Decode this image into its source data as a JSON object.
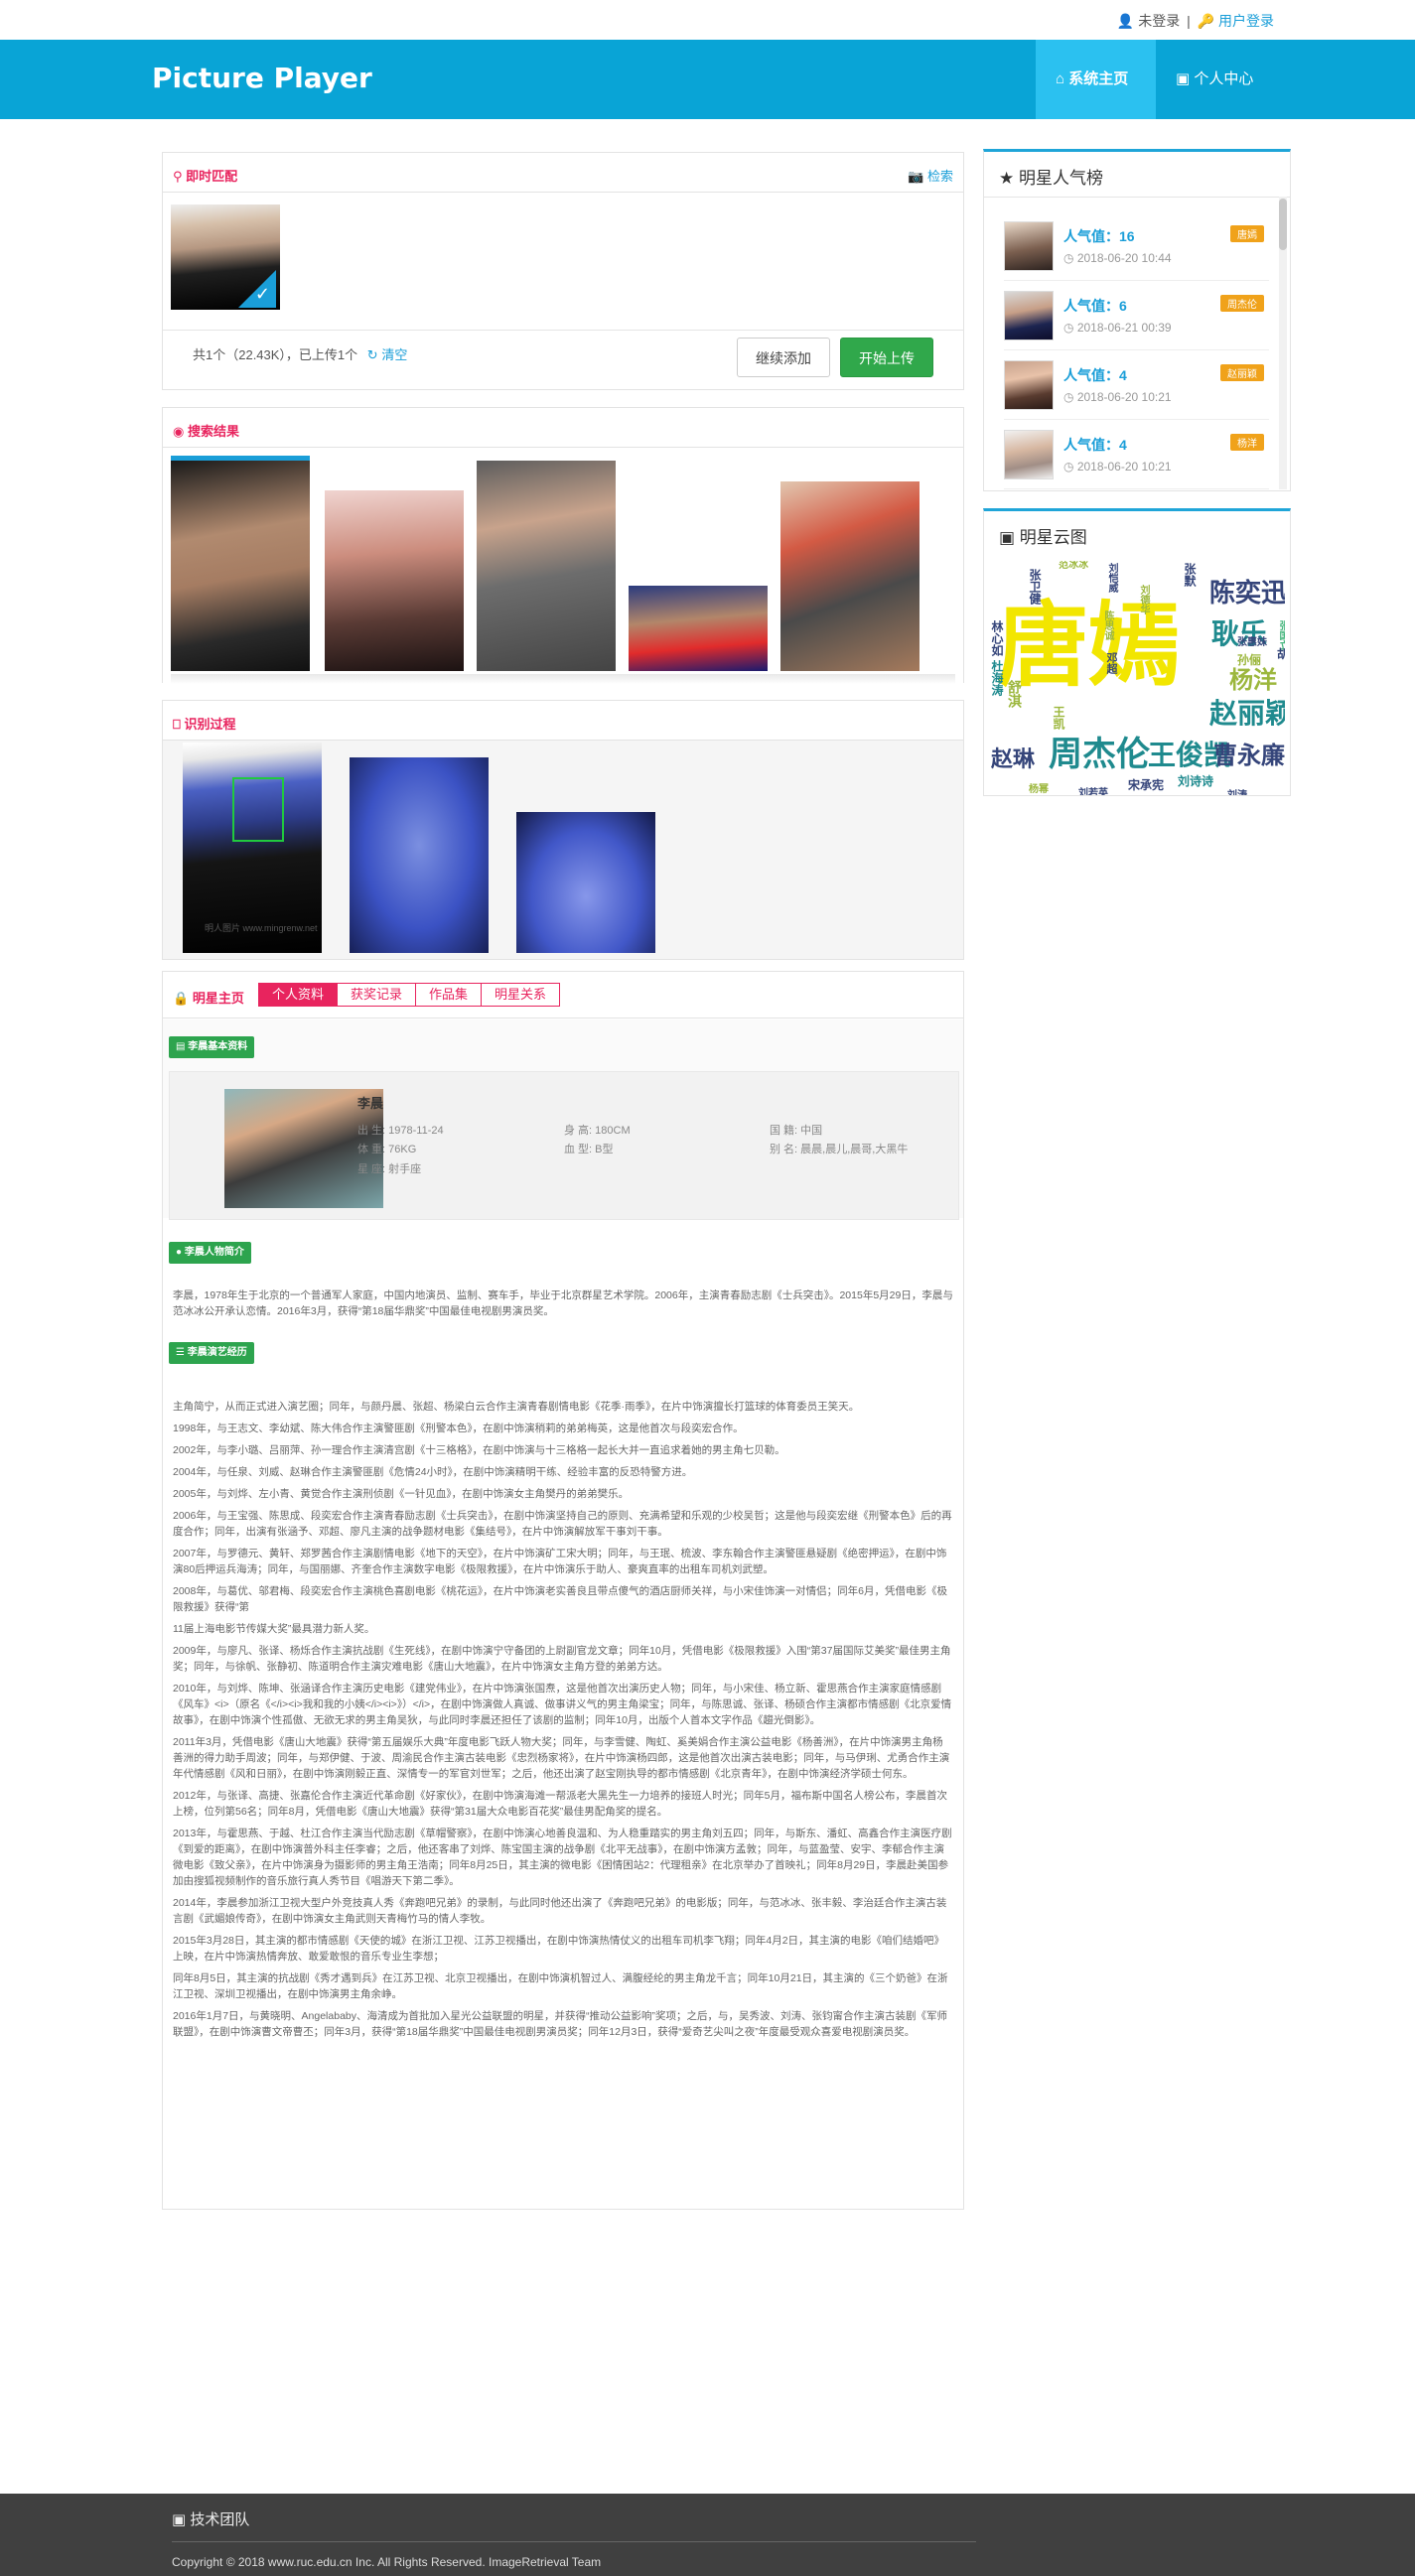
{
  "topbar": {
    "status": "未登录",
    "sep": "|",
    "login": "用户登录"
  },
  "nav": {
    "brand": "Picture Player",
    "home": "系统主页",
    "personal": "个人中心"
  },
  "match": {
    "title": "即时匹配",
    "search_link": "检索",
    "summary": "共1个（22.43K），已上传1个",
    "clear": "清空",
    "continue": "继续添加",
    "upload": "开始上传"
  },
  "results": {
    "title": "搜索结果"
  },
  "process": {
    "title": "识别过程",
    "watermark": "明人图片 www.mingrenw.net"
  },
  "star": {
    "title": "明星主页",
    "tabs": [
      "个人资料",
      "获奖记录",
      "作品集",
      "明星关系"
    ],
    "basic_tag": "李晨基本资料",
    "name": "李晨",
    "birth": "出 生: 1978-11-24",
    "height": "身 高: 180CM",
    "nation": "国 籍: 中国",
    "weight": "体 重: 76KG",
    "blood": "血 型: B型",
    "alias": "别 名: 晨晨,晨儿,晨哥,大黑牛",
    "sign": "星 座: 射手座",
    "intro_tag": "李晨人物简介",
    "intro": "李晨，1978年生于北京的一个普通军人家庭，中国内地演员、监制、赛车手，毕业于北京群星艺术学院。2006年，主演青春励志剧《士兵突击》。2015年5月29日，李晨与范冰冰公开承认恋情。2016年3月，获得“第18届华鼎奖”中国最佳电视剧男演员奖。",
    "career_tag": "李晨演艺经历",
    "career": [
      "主角简宁，从而正式进入演艺圈；同年，与颜丹晨、张超、杨梁白云合作主演青春剧情电影《花季·雨季》，在片中饰演擅长打篮球的体育委员王笑天。",
      "1998年，与王志文、李幼斌、陈大伟合作主演警匪剧《刑警本色》，在剧中饰演稍莉的弟弟梅英，这是他首次与段奕宏合作。",
      "2002年，与李小璐、吕丽萍、孙一理合作主演清宫剧《十三格格》，在剧中饰演与十三格格一起长大并一直追求着她的男主角七贝勒。",
      "2004年，与任泉、刘威、赵琳合作主演警匪剧《危情24小时》，在剧中饰演精明干练、经验丰富的反恐特警方进。",
      "2005年，与刘烨、左小青、黄觉合作主演刑侦剧《一针见血》，在剧中饰演女主角樊丹的弟弟樊乐。",
      "2006年，与王宝强、陈思成、段奕宏合作主演青春励志剧《士兵突击》，在剧中饰演坚持自己的原则、充满希望和乐观的少校吴哲；这是他与段奕宏继《刑警本色》后的再度合作；同年，出演有张涵予、邓超、廖凡主演的战争题材电影《集结号》，在片中饰演解放军干事刘干事。",
      "2007年，与罗德元、黄轩、郑罗茜合作主演剧情电影《地下的天空》，在片中饰演矿工宋大明；同年，与王珉、梳波、李东翰合作主演警匪悬疑剧《绝密押运》，在剧中饰演80后押运兵海涛；同年，与国丽娜、齐奎合作主演数字电影《极限救援》，在片中饰演乐于助人、豪爽直率的出租车司机刘武塑。",
      "2008年，与葛优、邬君梅、段奕宏合作主演桃色喜剧电影《桃花运》，在片中饰演老实善良且带点傻气的酒店厨师关祥，与小宋佳饰演一对情侣；同年6月，凭借电影《极限救援》获得“第",
      "11届上海电影节传媒大奖”最具潜力新人奖。",
      "2009年，与廖凡、张译、杨烁合作主演抗战剧《生死线》，在剧中饰演宁守备团的上尉副官龙文章；同年10月，凭借电影《极限救援》入围“第37届国际艾美奖”最佳男主角奖；同年，与徐帆、张静初、陈道明合作主演灾难电影《唐山大地震》，在片中饰演女主角方登的弟弟方达。",
      "2010年，与刘烨、陈坤、张涵译合作主演历史电影《建党伟业》，在片中饰演张国焘，这是他首次出演历史人物；同年，与小宋佳、杨立新、霍思燕合作主演家庭情感剧《风车》<i>（原名《</i><i>我和我的小姨</i><i>》）</i>，在剧中饰演做人真诚、做事讲义气的男主角梁宝；同年，与陈思诚、张译、杨硕合作主演都市情感剧《北京爱情故事》，在剧中饰演个性孤傲、无欲无求的男主角吴狄，与此同时李晨还担任了该剧的监制；同年10月，出版个人首本文字作品《趨光倒影》。",
      "2011年3月，凭借电影《唐山大地震》获得“第五届娱乐大典”年度电影飞跃人物大奖；同年，与李雪健、陶虹、奚美娟合作主演公益电影《杨善洲》，在片中饰演男主角杨善洲的得力助手周波；同年，与郑伊健、于波、周渝民合作主演古装电影《忠烈杨家将》，在片中饰演杨四郎，这是他首次出演古装电影；同年，与马伊琍、尤勇合作主演年代情感剧《风和日丽》，在剧中饰演刚毅正直、深情专一的军官刘世军；之后，他还出演了赵宝刚执导的都市情感剧《北京青年》，在剧中饰演经济学硕士何东。",
      "2012年，与张译、高捷、张嘉伦合作主演近代革命剧《好家伙》，在剧中饰演海滩一帮派老大黑先生一力培养的接班人时光；同年5月，福布斯中国名人榜公布，李晨首次上榜，位列第56名；同年8月，凭借电影《唐山大地震》获得“第31届大众电影百花奖”最佳男配角奖的提名。",
      "2013年，与霍思燕、于越、杜江合作主演当代励志剧《草帽警察》，在剧中饰演心地善良温和、为人稳重踏实的男主角刘五四；同年，与斯东、潘虹、高鑫合作主演医疗剧《到爱的距离》，在剧中饰演普外科主任李睿；之后，他还客串了刘烨、陈宝国主演的战争剧《北平无战事》，在剧中饰演方孟敦；同年，与蓝盈莹、安宇、李郁合作主演微电影《致父亲》，在片中饰演身为摄影师的男主角王浩南；同年8月25日，其主演的微电影《困情困站2：代理租亲》在北京举办了首映礼；同年8月29日，李晨赴美国参加由搜狐视频制作的音乐旅行真人秀节目《唱游天下第二季》。",
      "2014年，李晨参加浙江卫视大型户外竞技真人秀《奔跑吧兄弟》的录制，与此同时他还出演了《奔跑吧兄弟》的电影版；同年，与范冰冰、张丰毅、李治廷合作主演古装言剧《武媚娘传奇》，在剧中饰演女主角武则天青梅竹马的情人李牧。",
      "2015年3月28日，其主演的都市情感剧《天使的城》在浙江卫视、江苏卫视播出，在剧中饰演热情仗义的出租车司机李飞翔；同年4月2日，其主演的电影《咱们结婚吧》上映，在片中饰演热情奔放、敢爱敢恨的音乐专业生李想；",
      "同年8月5日，其主演的抗战剧《秀才遇到兵》在江苏卫视、北京卫视播出，在剧中饰演机智过人、满腹经纶的男主角龙千言；同年10月21日，其主演的《三个奶爸》在浙江卫视、深圳卫视播出，在剧中饰演男主角余峥。",
      "2016年1月7日，与黄晓明、Angelababy、海清成为首批加入星光公益联盟的明星，并获得“推动公益影响”奖项；之后，与，吴秀波、刘涛、张钧甯合作主演古装剧《军师联盟》，在剧中饰演曹文帝曹丕；同年3月，获得“第18届华鼎奖”中国最佳电视剧男演员奖；同年12月3日，获得“爱奇艺尖叫之夜”年度最受观众喜爱电视剧演员奖。"
    ]
  },
  "ranking": {
    "title": "明星人气榜",
    "items": [
      {
        "pop": "人气值：16",
        "date": "2018-06-20 10:44",
        "badge": "唐嫣"
      },
      {
        "pop": "人气值：6",
        "date": "2018-06-21 00:39",
        "badge": "周杰伦"
      },
      {
        "pop": "人气值：4",
        "date": "2018-06-20 10:21",
        "badge": "赵丽颖"
      },
      {
        "pop": "人气值：4",
        "date": "2018-06-20 10:21",
        "badge": "杨洋"
      }
    ]
  },
  "cloud": {
    "title": "明星云图",
    "words": [
      "唐嫣",
      "陈奕迅",
      "耿乐",
      "杨洋",
      "赵丽颖",
      "周杰伦",
      "王俊凯",
      "曹永廉",
      "赵琳",
      "张卫健",
      "范冰冰",
      "刘恺威",
      "林心如",
      "舒淇",
      "陈思诚",
      "刘若英",
      "杜海涛",
      "刘德华",
      "张国立",
      "张惠妹",
      "孙俪",
      "胡歌",
      "刘诗诗",
      "宋承宪",
      "张默",
      "邓超",
      "杨幂",
      "刘涛",
      "王凯"
    ],
    "colors": {
      "big": "#f2e600",
      "navy": "#35457a",
      "teal": "#1f8a8e",
      "olive": "#9cb73d",
      "green": "#41b47a"
    }
  },
  "footer": {
    "team": "技术团队",
    "copyright": "Copyright © 2018 www.ruc.edu.cn Inc. All Rights Reserved. ImageRetrieval Team"
  }
}
